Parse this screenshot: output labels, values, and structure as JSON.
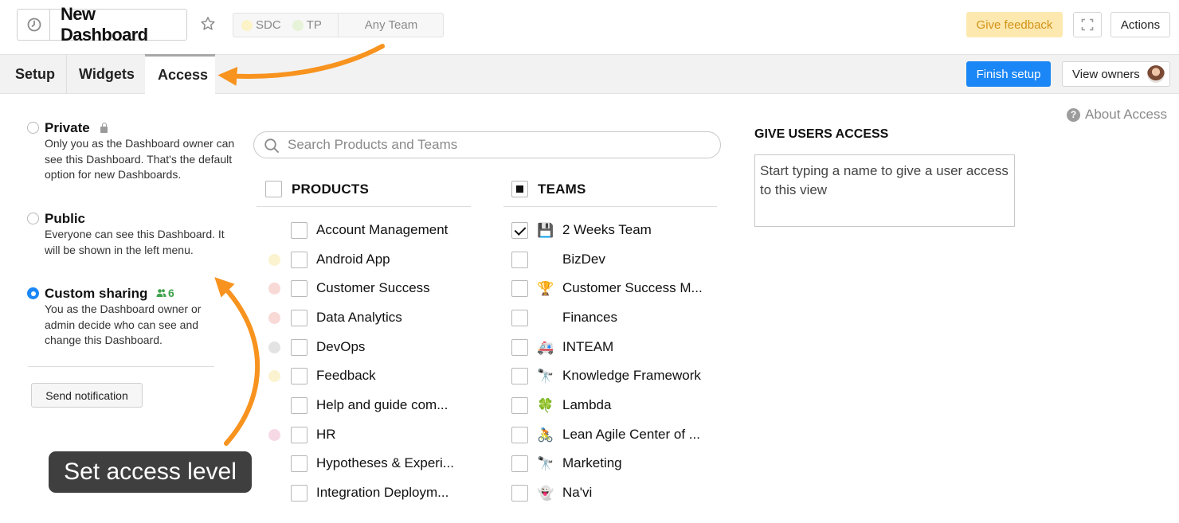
{
  "header": {
    "dashboard_title": "New Dashboard",
    "tags": [
      {
        "label": "SDC",
        "color": "#fdf3c8"
      },
      {
        "label": "TP",
        "color": "#e6f3d8"
      }
    ],
    "team_selector": "Any Team",
    "feedback_label": "Give feedback",
    "actions_label": "Actions",
    "icons": [
      "clock-icon",
      "star-icon",
      "expand-icon"
    ]
  },
  "tabs": [
    {
      "label": "Setup",
      "active": false
    },
    {
      "label": "Widgets",
      "active": false
    },
    {
      "label": "Access",
      "active": true
    }
  ],
  "toolbar": {
    "finish_label": "Finish setup",
    "owners_label": "View owners",
    "accent": "#1b86f5"
  },
  "access_options": [
    {
      "title": "Private",
      "description": "Only you as the Dashboard owner can see this Dashboard. That's the default option for new Dashboards.",
      "selected": false,
      "icon": "lock-icon"
    },
    {
      "title": "Public",
      "description": "Everyone can see this Dashboard. It will be shown in the left menu.",
      "selected": false
    },
    {
      "title": "Custom sharing",
      "description": "You as the Dashboard owner or admin decide who can see and change this Dashboard.",
      "selected": true,
      "icon": "users-icon",
      "count": "6"
    }
  ],
  "send_notification_label": "Send notification",
  "search_placeholder": "Search Products and Teams",
  "products": {
    "header": "PRODUCTS",
    "header_state": "unchecked",
    "items": [
      {
        "label": "Account Management",
        "dot": null,
        "checked": false
      },
      {
        "label": "Android App",
        "dot": "#fbf3cf",
        "checked": false
      },
      {
        "label": "Customer Success",
        "dot": "#f9d9d6",
        "checked": false
      },
      {
        "label": "Data Analytics",
        "dot": "#f9d9d6",
        "checked": false
      },
      {
        "label": "DevOps",
        "dot": "#e3e3e3",
        "checked": false
      },
      {
        "label": "Feedback",
        "dot": "#fbf3cf",
        "checked": false
      },
      {
        "label": "Help and guide com...",
        "dot": null,
        "checked": false
      },
      {
        "label": "HR",
        "dot": "#f7d9e6",
        "checked": false
      },
      {
        "label": "Hypotheses & Experi...",
        "dot": null,
        "checked": false
      },
      {
        "label": "Integration Deploym...",
        "dot": null,
        "checked": false
      }
    ]
  },
  "teams": {
    "header": "TEAMS",
    "header_state": "partial",
    "items": [
      {
        "label": "2 Weeks Team",
        "emoji": "💾",
        "checked": true
      },
      {
        "label": "BizDev",
        "emoji": "",
        "checked": false
      },
      {
        "label": "Customer Success M...",
        "emoji": "🏆",
        "checked": false
      },
      {
        "label": "Finances",
        "emoji": "",
        "checked": false
      },
      {
        "label": "INTEAM",
        "emoji": "🚑",
        "checked": false
      },
      {
        "label": "Knowledge Framework",
        "emoji": "🔭",
        "checked": false
      },
      {
        "label": "Lambda",
        "emoji": "🍀",
        "checked": false
      },
      {
        "label": "Lean Agile Center of ...",
        "emoji": "🚴",
        "checked": false
      },
      {
        "label": "Marketing",
        "emoji": "🔭",
        "checked": false
      },
      {
        "label": "Na'vi",
        "emoji": "👻",
        "checked": false
      }
    ]
  },
  "give_access": {
    "about_label": "About Access",
    "header": "GIVE USERS ACCESS",
    "placeholder": "Start typing a name to give a user access to this view"
  },
  "annotation": {
    "callout_text": "Set access level",
    "arrow_color": "#f7931e"
  }
}
